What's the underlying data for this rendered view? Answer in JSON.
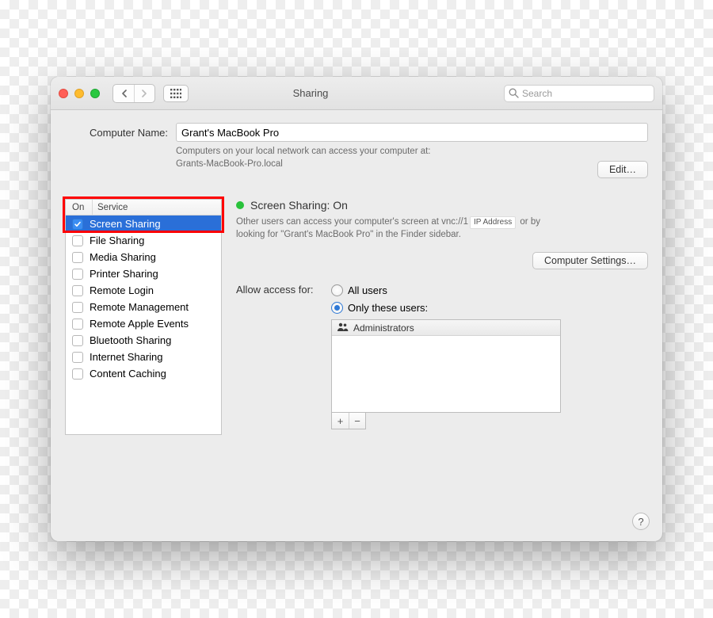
{
  "toolbar": {
    "title": "Sharing",
    "search_placeholder": "Search"
  },
  "computer_name": {
    "label": "Computer Name:",
    "value": "Grant's MacBook Pro",
    "subtext_l1": "Computers on your local network can access your computer at:",
    "subtext_l2": "Grants-MacBook-Pro.local",
    "edit_label": "Edit…"
  },
  "list": {
    "col_on": "On",
    "col_service": "Service",
    "items": [
      {
        "on": true,
        "label": "Screen Sharing",
        "selected": true
      },
      {
        "on": false,
        "label": "File Sharing"
      },
      {
        "on": false,
        "label": "Media Sharing"
      },
      {
        "on": false,
        "label": "Printer Sharing"
      },
      {
        "on": false,
        "label": "Remote Login"
      },
      {
        "on": false,
        "label": "Remote Management"
      },
      {
        "on": false,
        "label": "Remote Apple Events"
      },
      {
        "on": false,
        "label": "Bluetooth Sharing"
      },
      {
        "on": false,
        "label": "Internet Sharing"
      },
      {
        "on": false,
        "label": "Content Caching"
      }
    ]
  },
  "detail": {
    "status_text": "Screen Sharing: On",
    "desc_pre": "Other users can access your computer's screen at vnc://1",
    "desc_ip_badge": "IP Address",
    "desc_post": " or by looking for \"Grant's MacBook Pro\" in the Finder sidebar.",
    "computer_settings_label": "Computer Settings…",
    "access_label": "Allow access for:",
    "radio_all": "All users",
    "radio_only": "Only these users:",
    "access_choice": "only",
    "user0": "Administrators",
    "plus": "+",
    "minus": "−",
    "help": "?"
  },
  "annotation": {
    "highlight_target": "service-list-header-and-first-row"
  }
}
